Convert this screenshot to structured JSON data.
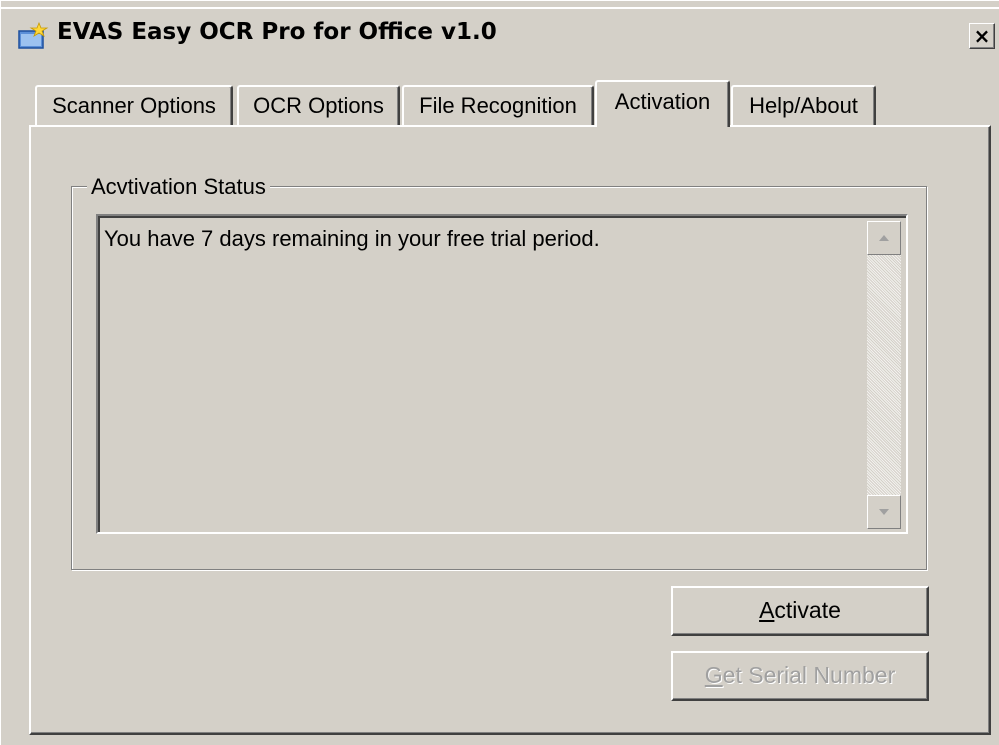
{
  "window": {
    "title": "EVAS Easy OCR Pro for Office v1.0",
    "close_glyph": "×",
    "icon": "app-star-folder-icon"
  },
  "tabs": [
    {
      "label": "Scanner Options",
      "active": false
    },
    {
      "label": "OCR Options",
      "active": false
    },
    {
      "label": "File Recognition",
      "active": false
    },
    {
      "label": "Activation",
      "active": true
    },
    {
      "label": "Help/About",
      "active": false
    }
  ],
  "activation": {
    "group_label": "Acvtivation Status",
    "status_message": "You have 7 days remaining in your free trial period.",
    "activate_mnemonic": "A",
    "activate_rest": "ctivate",
    "serial_mnemonic": "G",
    "serial_rest": "et Serial Number",
    "serial_enabled": false
  },
  "colors": {
    "face": "#d4d0c8",
    "highlight": "#ffffff",
    "shadow": "#808080",
    "dark_shadow": "#404040",
    "disabled_text": "#a0a0a0"
  }
}
